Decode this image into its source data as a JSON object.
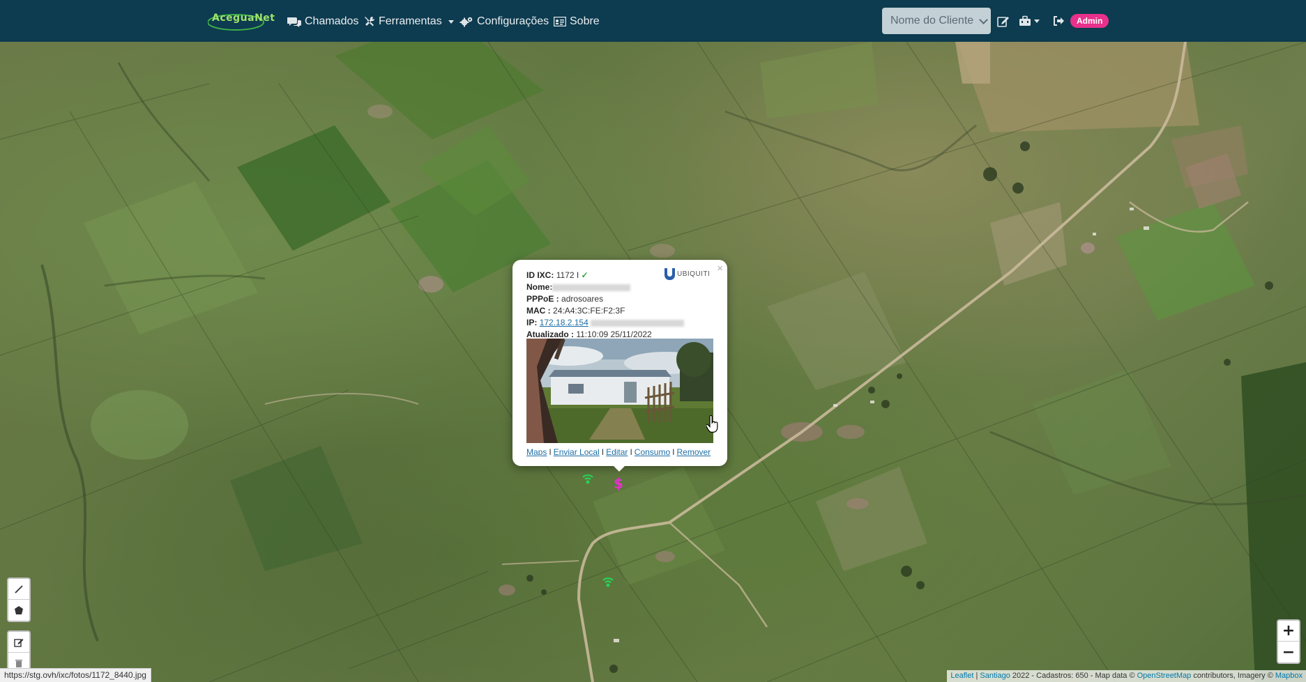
{
  "navbar": {
    "brand": "AceguaNet",
    "items": [
      {
        "label": "Chamados",
        "icon": "comments-icon"
      },
      {
        "label": "Ferramentas",
        "icon": "tools-icon"
      },
      {
        "label": "Configurações",
        "icon": "cogs-icon"
      },
      {
        "label": "Sobre",
        "icon": "id-card-icon"
      }
    ],
    "client_select": "Nome do Cliente",
    "admin_badge": "Admin",
    "colors": {
      "bg": "#0d3b4f",
      "badge": "#e8318b"
    }
  },
  "popup": {
    "close": "×",
    "id_label": "ID IXC:",
    "id_value": "1172 I",
    "name_label": "Nome:",
    "pppoe_label": "PPPoE :",
    "pppoe_value": "adrosoares",
    "mac_label": "MAC :",
    "mac_value": "24:A4:3C:FE:F2:3F",
    "ip_label": "IP:",
    "ip_value": "172.18.2.154",
    "updated_label": "Atualizado :",
    "updated_value": "11:10:09 25/11/2022",
    "brand_logo": "UBIQUITI",
    "links": [
      "Maps",
      "Enviar Local",
      "Editar",
      "Consumo",
      "Remover"
    ],
    "link_separator": "I"
  },
  "map_controls": {
    "draw_tools": [
      "polyline-icon",
      "polygon-icon"
    ],
    "edit_tools": [
      "edit-icon",
      "trash-icon"
    ],
    "zoom_in": "+",
    "zoom_out": "−"
  },
  "status_url": "https://stg.ovh/ixc/fotos/1172_8440.jpg",
  "attribution": {
    "leaflet": "Leaflet",
    "separator": " | ",
    "santiago": "Santiago",
    "text1": " 2022 - Cadastros: 650 - Map data © ",
    "osm": "OpenStreetMap",
    "text2": " contributors, Imagery © ",
    "mapbox": "Mapbox"
  }
}
